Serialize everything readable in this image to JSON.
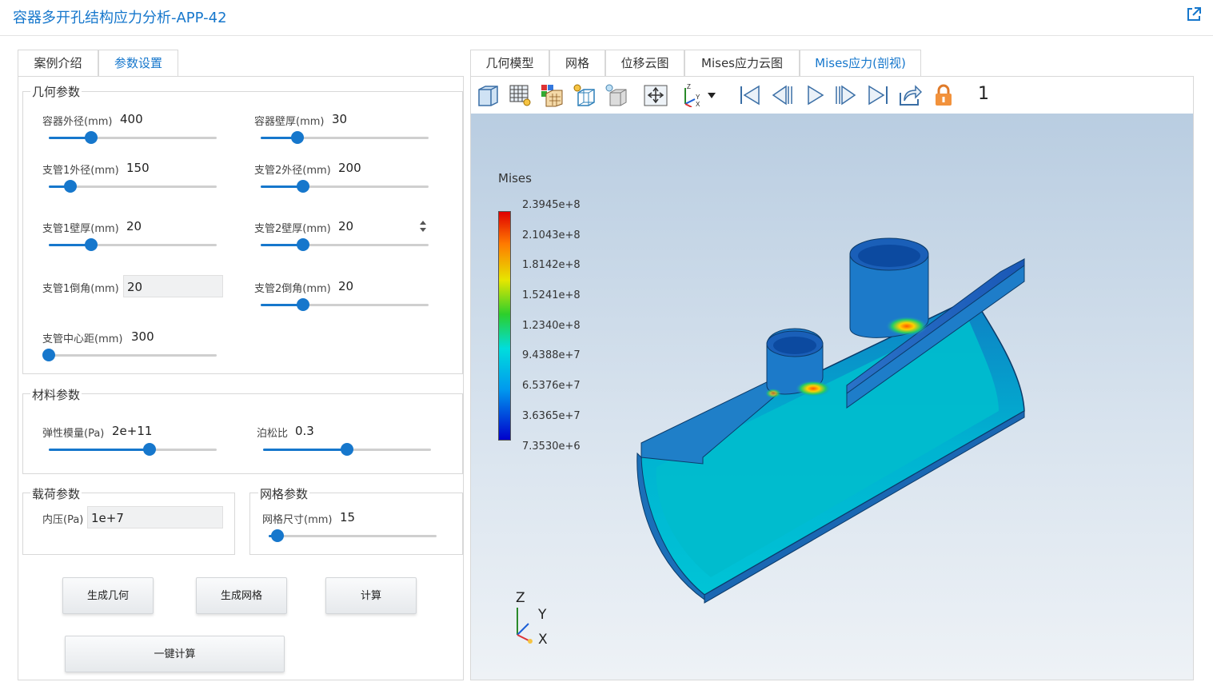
{
  "app": {
    "title": "容器多开孔结构应力分析-APP-42"
  },
  "left_tabs": [
    {
      "label": "案例介绍"
    },
    {
      "label": "参数设置"
    }
  ],
  "geometry": {
    "title": "几何参数",
    "outer_diameter": {
      "label": "容器外径(mm)",
      "value": "400",
      "fraction": 0.25
    },
    "wall_thickness": {
      "label": "容器壁厚(mm)",
      "value": "30",
      "fraction": 0.22
    },
    "pipe1_od": {
      "label": "支管1外径(mm)",
      "value": "150",
      "fraction": 0.13
    },
    "pipe2_od": {
      "label": "支管2外径(mm)",
      "value": "200",
      "fraction": 0.25
    },
    "pipe1_wall": {
      "label": "支管1壁厚(mm)",
      "value": "20",
      "fraction": 0.25
    },
    "pipe2_wall": {
      "label": "支管2壁厚(mm)",
      "value": "20",
      "fraction": 0.25
    },
    "pipe1_chamfer": {
      "label": "支管1倒角(mm)",
      "value": "20"
    },
    "pipe2_chamfer": {
      "label": "支管2倒角(mm)",
      "value": "20",
      "fraction": 0.25
    },
    "center_distance": {
      "label": "支管中心距(mm)",
      "value": "300",
      "fraction": 0.0
    }
  },
  "material": {
    "title": "材料参数",
    "youngs": {
      "label": "弹性模量(Pa)",
      "value": "2e+11",
      "fraction": 0.6
    },
    "poisson": {
      "label": "泊松比",
      "value": "0.3",
      "fraction": 0.5
    }
  },
  "load": {
    "title": "载荷参数",
    "pressure": {
      "label": "内压(Pa)",
      "value": "1e+7"
    }
  },
  "mesh": {
    "title": "网格参数",
    "size": {
      "label": "网格尺寸(mm)",
      "value": "15",
      "fraction": 0.05
    }
  },
  "buttons": {
    "gen_geometry": "生成几何",
    "gen_mesh": "生成网格",
    "compute": "计算",
    "one_click": "一键计算"
  },
  "right_tabs": [
    {
      "label": "几何模型"
    },
    {
      "label": "网格"
    },
    {
      "label": "位移云图"
    },
    {
      "label": "Mises应力云图"
    },
    {
      "label": "Mises应力(剖视)"
    }
  ],
  "viewer": {
    "page_number": "1",
    "legend": {
      "title": "Mises",
      "labels": [
        "2.3945e+8",
        "2.1043e+8",
        "1.8142e+8",
        "1.5241e+8",
        "1.2340e+8",
        "9.4388e+7",
        "6.5376e+7",
        "3.6365e+7",
        "7.3530e+6"
      ]
    },
    "axes": {
      "z": "Z",
      "y": "Y",
      "x": "X"
    },
    "tools": [
      "view-box-icon",
      "mesh-grid-icon",
      "color-map-icon",
      "wireframe-icon",
      "shaded-icon",
      "fit-view-icon",
      "axis-orientation-icon",
      "first-frame-icon",
      "prev-frame-icon",
      "play-icon",
      "next-frame-icon",
      "last-frame-icon",
      "export-icon",
      "lock-icon"
    ]
  },
  "colors": {
    "accent": "#1677cc",
    "border": "#d8d8d8"
  }
}
